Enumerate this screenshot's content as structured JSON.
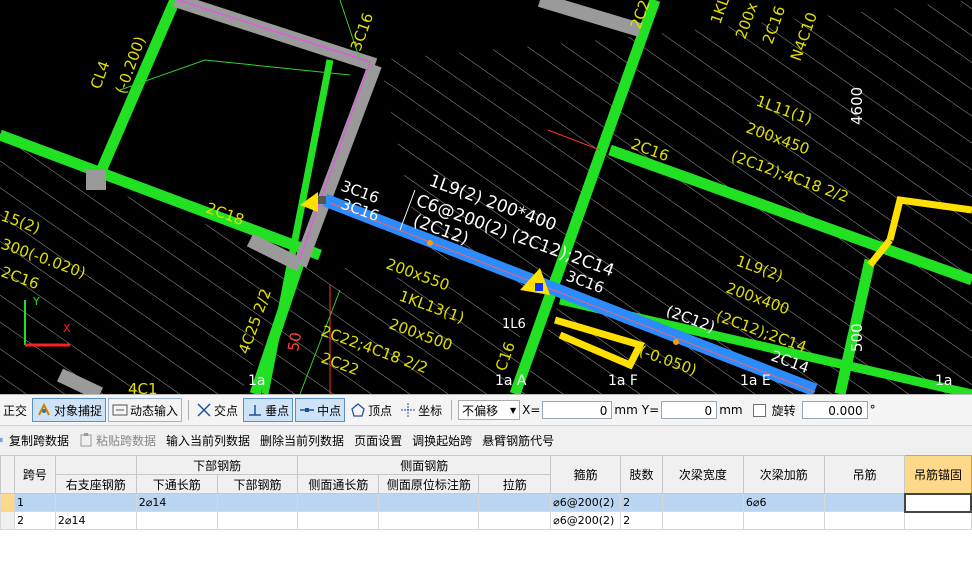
{
  "canvas": {
    "labels": [
      "3C16",
      "1KL",
      "200x",
      "2C16",
      "N4C10",
      "2C2",
      "CL4",
      "(-0.200)",
      "4600",
      "1L11(1)",
      "200x450",
      "(2C12);4C18 2/2",
      "2C16",
      "2C18",
      "15(2)",
      "300(-0.020)",
      "2C16",
      "3C16",
      "3C16",
      "1L9(2) 200*400",
      "C6@200(2) (2C12);2C14",
      "(2C12)",
      "3C16",
      "200x550",
      "1KL13(1)",
      "200x500",
      "2C22;4C18 2/2",
      "2C22",
      "4C25 2/2",
      "1L9(2)",
      "200x400",
      "(2C12);2C14",
      "(2C12)",
      "2C14",
      "(-0.050)",
      "500",
      "1L6",
      "1a A",
      "1a F",
      "1a E",
      "1a",
      "1a",
      "C16",
      "50",
      "4C1"
    ],
    "axes": {
      "x": "X",
      "y": "Y"
    }
  },
  "snapbar": {
    "ortho": "正交",
    "object_snap": "对象捕捉",
    "dynamic_input": "动态输入",
    "intersection": "交点",
    "perpendicular": "垂点",
    "midpoint": "中点",
    "vertex": "顶点",
    "coordinate": "坐标",
    "offset_mode": "不偏移",
    "x_label": "X=",
    "x_value": "0",
    "x_unit": "mm",
    "y_label": "Y=",
    "y_value": "0",
    "y_unit": "mm",
    "rotate_label": "旋转",
    "rotate_value": "0.000",
    "rotate_unit": "°"
  },
  "actbar": {
    "copy_span": "复制跨数据",
    "paste_span": "粘贴跨数据",
    "input_column": "输入当前列数据",
    "delete_column": "删除当前列数据",
    "page_setup": "页面设置",
    "adjust_start": "调换起始跨",
    "cantilever_code": "悬臂钢筋代号"
  },
  "grid": {
    "headers": {
      "span_no": "跨号",
      "bottom_rebar": "下部钢筋",
      "side_rebar": "侧面钢筋",
      "right_support": "右支座钢筋",
      "bottom_through": "下通长筋",
      "bottom_bar": "下部钢筋",
      "side_through": "侧面通长筋",
      "side_orig": "侧面原位标注筋",
      "tie": "拉筋",
      "stirrup": "箍筋",
      "legs": "肢数",
      "secondary_width": "次梁宽度",
      "secondary_add": "次梁加筋",
      "hanger": "吊筋",
      "hanger_anchor": "吊筋锚固"
    },
    "rows": [
      {
        "span": "1",
        "right_support": "",
        "bottom_through": "2⌀14",
        "bottom_bar": "",
        "side_through": "",
        "side_orig": "",
        "tie": "",
        "stirrup": "⌀6@200(2)",
        "legs": "2",
        "secondary_width": "",
        "secondary_add": "6⌀6",
        "hanger": "",
        "hanger_anchor": ""
      },
      {
        "span": "2",
        "right_support": "2⌀14",
        "bottom_through": "",
        "bottom_bar": "",
        "side_through": "",
        "side_orig": "",
        "tie": "",
        "stirrup": "⌀6@200(2)",
        "legs": "2",
        "secondary_width": "",
        "secondary_add": "",
        "hanger": "",
        "hanger_anchor": ""
      }
    ]
  }
}
